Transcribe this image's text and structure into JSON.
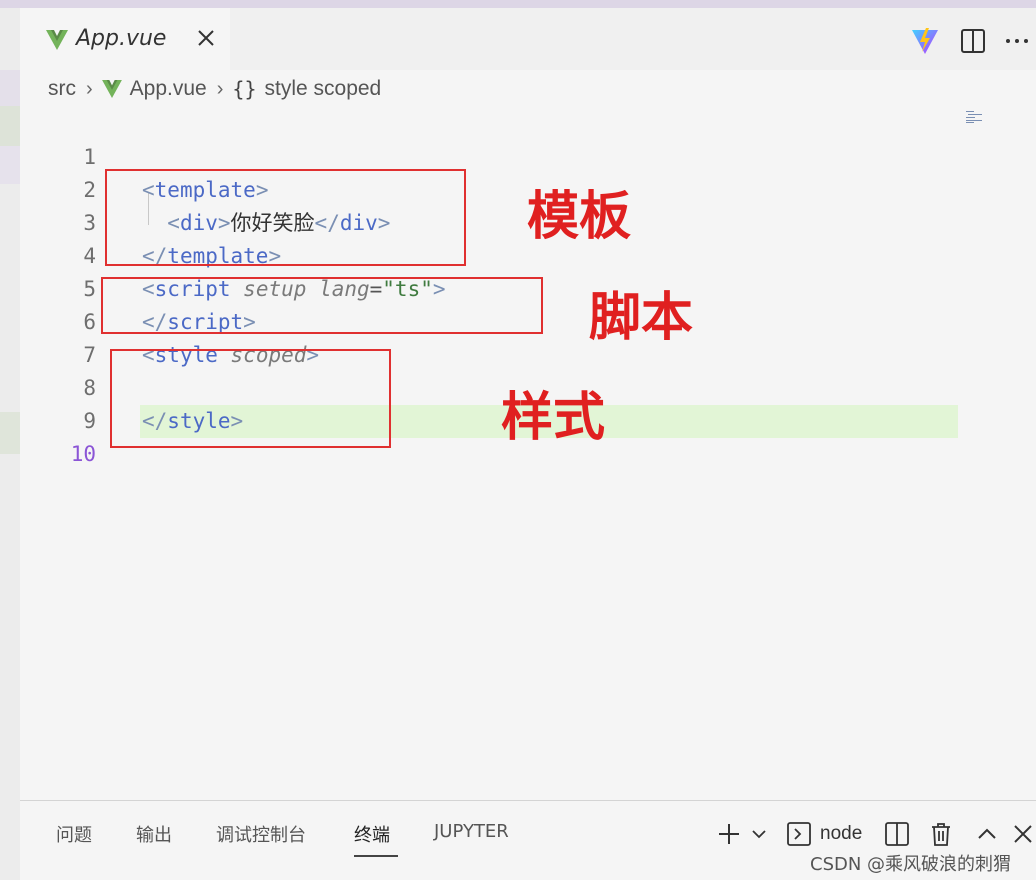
{
  "tab": {
    "label": "App.vue"
  },
  "breadcrumb": {
    "folder": "src",
    "file": "App.vue",
    "symbol_prefix": "{}",
    "symbol": "style scoped"
  },
  "editor": {
    "active_line": 10,
    "lines": [
      {
        "number": "1"
      },
      {
        "number": "2"
      },
      {
        "number": "3"
      },
      {
        "number": "4"
      },
      {
        "number": "5"
      },
      {
        "number": "6"
      },
      {
        "number": "7"
      },
      {
        "number": "8"
      },
      {
        "number": "9"
      },
      {
        "number": "10"
      }
    ],
    "code": {
      "l3_tag": "template",
      "l4_tag": "div",
      "l4_text": "你好笑脸",
      "l5_tag": "template",
      "l6_tag": "script",
      "l6_attr1": "setup",
      "l6_attr2": "lang",
      "l6_value": "\"ts\"",
      "l7_tag": "script",
      "l8_tag": "style",
      "l8_attr": "scoped",
      "l10_tag": "style"
    }
  },
  "annotations": {
    "template": "模板",
    "script": "脚本",
    "style": "样式"
  },
  "colors": {
    "annotation": "#e02020",
    "box": "#e03030",
    "tag": "#4b69c6",
    "string": "#3f7b3f",
    "highlight": "#e2f5d6"
  },
  "panel": {
    "tabs": [
      "问题",
      "输出",
      "调试控制台",
      "终端",
      "JUPYTER"
    ],
    "active_tab": "终端",
    "terminal_name": "node",
    "icons": [
      "plus-icon",
      "chevron-down-icon",
      "terminal-icon",
      "split-icon",
      "trash-icon",
      "chevron-up-icon",
      "close-icon"
    ]
  },
  "watermark": "CSDN @乘风破浪的刺猬"
}
